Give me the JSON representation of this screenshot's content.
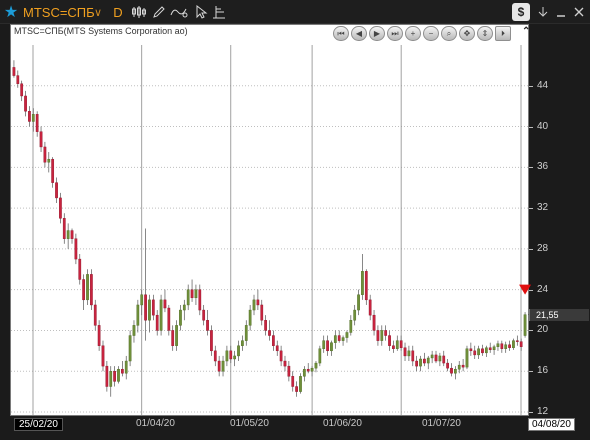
{
  "toolbar": {
    "symbol": "MTSC=СПБ",
    "symbol_caret": "∨",
    "period": "D",
    "tools": [
      "bar-chart-icon",
      "draw-pencil-icon",
      "indicator-icon",
      "cursor-icon",
      "chart-settings-icon"
    ],
    "right_tools": [
      "dollar-icon",
      "download-icon",
      "minimize-icon",
      "close-icon"
    ],
    "dollar_label": "$"
  },
  "chart": {
    "title": "MTSC=СПБ(MTS Systems Corporation ao)",
    "last_price": "21,55",
    "nav_buttons": [
      "first",
      "prev",
      "play",
      "next",
      "zoom-in",
      "zoom-out",
      "search",
      "fit-horizontal",
      "fit-vertical",
      "end"
    ]
  },
  "chart_data": {
    "type": "candlestick",
    "title": "MTSC=СПБ(MTS Systems Corporation ao)",
    "y_ticks": [
      12,
      16,
      20,
      24,
      28,
      32,
      36,
      40,
      44
    ],
    "ylim": [
      12,
      48
    ],
    "x_labels": [
      "25/02/20",
      "01/04/20",
      "01/05/20",
      "01/06/20",
      "01/07/20",
      "04/08/20"
    ],
    "last_price": 21.55,
    "up_color": "#6f8f3a",
    "down_color": "#c8243f",
    "alert_marker": 24,
    "candles": [
      [
        45.8,
        46.5,
        44.8,
        45.0
      ],
      [
        45.0,
        45.5,
        43.8,
        44.2
      ],
      [
        44.2,
        44.5,
        42.5,
        43.0
      ],
      [
        43.0,
        43.5,
        41.0,
        41.5
      ],
      [
        41.5,
        42.0,
        40.0,
        40.5
      ],
      [
        40.5,
        41.8,
        39.5,
        41.2
      ],
      [
        41.2,
        41.5,
        39.0,
        39.5
      ],
      [
        39.5,
        40.0,
        37.5,
        38.0
      ],
      [
        38.0,
        38.5,
        36.0,
        36.5
      ],
      [
        36.5,
        37.5,
        35.5,
        36.8
      ],
      [
        36.8,
        37.0,
        34.0,
        34.5
      ],
      [
        34.5,
        35.0,
        32.5,
        33.0
      ],
      [
        33.0,
        33.5,
        30.5,
        31.0
      ],
      [
        31.0,
        31.5,
        28.5,
        29.0
      ],
      [
        29.0,
        30.5,
        28.0,
        29.8
      ],
      [
        29.8,
        30.0,
        28.5,
        29.0
      ],
      [
        29.0,
        29.5,
        26.5,
        27.0
      ],
      [
        27.0,
        27.5,
        24.5,
        25.0
      ],
      [
        25.0,
        25.5,
        22.0,
        23.0
      ],
      [
        23.0,
        26.0,
        22.5,
        25.5
      ],
      [
        25.5,
        26.0,
        22.0,
        22.5
      ],
      [
        22.5,
        23.0,
        20.0,
        20.5
      ],
      [
        20.5,
        21.0,
        18.0,
        18.5
      ],
      [
        18.5,
        19.0,
        16.0,
        16.5
      ],
      [
        16.5,
        17.0,
        14.0,
        14.5
      ],
      [
        14.5,
        16.5,
        13.5,
        16.0
      ],
      [
        16.0,
        16.5,
        14.5,
        15.0
      ],
      [
        15.0,
        16.5,
        14.8,
        16.2
      ],
      [
        16.2,
        17.0,
        15.5,
        15.8
      ],
      [
        15.8,
        17.5,
        15.2,
        17.0
      ],
      [
        17.0,
        20.0,
        16.5,
        19.5
      ],
      [
        19.5,
        21.0,
        18.8,
        20.5
      ],
      [
        20.5,
        23.0,
        19.8,
        22.5
      ],
      [
        22.5,
        24.0,
        21.5,
        23.5
      ],
      [
        23.5,
        30.0,
        19.0,
        21.0
      ],
      [
        21.0,
        23.5,
        19.8,
        23.0
      ],
      [
        23.0,
        23.5,
        21.0,
        21.5
      ],
      [
        21.5,
        22.0,
        19.5,
        20.0
      ],
      [
        20.0,
        23.5,
        19.5,
        23.0
      ],
      [
        23.0,
        24.0,
        21.8,
        22.2
      ],
      [
        22.2,
        22.5,
        19.5,
        20.0
      ],
      [
        20.0,
        20.5,
        18.0,
        18.5
      ],
      [
        18.5,
        21.0,
        18.0,
        20.5
      ],
      [
        20.5,
        22.5,
        20.0,
        22.0
      ],
      [
        22.0,
        23.0,
        21.0,
        22.5
      ],
      [
        22.5,
        24.5,
        22.0,
        24.0
      ],
      [
        24.0,
        25.0,
        22.8,
        23.2
      ],
      [
        23.2,
        24.5,
        22.5,
        24.0
      ],
      [
        24.0,
        24.5,
        21.5,
        22.0
      ],
      [
        22.0,
        22.5,
        20.5,
        21.0
      ],
      [
        21.0,
        22.0,
        19.5,
        20.0
      ],
      [
        20.0,
        20.5,
        17.5,
        18.0
      ],
      [
        18.0,
        18.5,
        16.5,
        17.0
      ],
      [
        17.0,
        17.5,
        15.5,
        16.0
      ],
      [
        16.0,
        17.5,
        15.5,
        17.0
      ],
      [
        17.0,
        18.5,
        16.5,
        18.0
      ],
      [
        18.0,
        18.5,
        16.8,
        17.2
      ],
      [
        17.2,
        18.0,
        16.5,
        17.5
      ],
      [
        17.5,
        19.0,
        17.0,
        18.5
      ],
      [
        18.5,
        19.5,
        18.0,
        19.0
      ],
      [
        19.0,
        21.0,
        18.5,
        20.5
      ],
      [
        20.5,
        22.5,
        20.0,
        22.0
      ],
      [
        22.0,
        23.5,
        21.5,
        23.0
      ],
      [
        23.0,
        24.0,
        22.0,
        22.5
      ],
      [
        22.5,
        23.0,
        20.5,
        21.0
      ],
      [
        21.0,
        21.5,
        19.5,
        20.0
      ],
      [
        20.0,
        21.0,
        19.0,
        19.5
      ],
      [
        19.5,
        20.0,
        18.0,
        18.5
      ],
      [
        18.5,
        19.0,
        17.5,
        18.0
      ],
      [
        18.0,
        18.5,
        16.5,
        17.0
      ],
      [
        17.0,
        17.5,
        16.0,
        16.5
      ],
      [
        16.5,
        17.0,
        15.0,
        15.5
      ],
      [
        15.5,
        16.0,
        14.0,
        14.5
      ],
      [
        14.5,
        15.0,
        13.5,
        14.0
      ],
      [
        14.0,
        15.8,
        13.8,
        15.5
      ],
      [
        15.5,
        16.5,
        15.0,
        16.2
      ],
      [
        16.2,
        16.8,
        15.8,
        16.0
      ],
      [
        16.0,
        16.5,
        15.5,
        16.3
      ],
      [
        16.3,
        17.0,
        15.9,
        16.8
      ],
      [
        16.8,
        18.5,
        16.5,
        18.2
      ],
      [
        18.2,
        19.5,
        17.8,
        19.0
      ],
      [
        19.0,
        19.5,
        17.5,
        18.0
      ],
      [
        18.0,
        19.0,
        17.5,
        18.8
      ],
      [
        18.8,
        20.0,
        18.2,
        19.5
      ],
      [
        19.5,
        20.0,
        18.8,
        19.0
      ],
      [
        19.0,
        19.5,
        18.5,
        19.3
      ],
      [
        19.3,
        20.0,
        18.8,
        19.8
      ],
      [
        19.8,
        21.5,
        19.5,
        21.0
      ],
      [
        21.0,
        22.5,
        20.5,
        22.0
      ],
      [
        22.0,
        24.0,
        21.5,
        23.5
      ],
      [
        23.5,
        27.5,
        23.0,
        25.8
      ],
      [
        25.8,
        26.0,
        22.5,
        23.0
      ],
      [
        23.0,
        23.5,
        21.0,
        21.5
      ],
      [
        21.5,
        22.0,
        19.5,
        20.0
      ],
      [
        20.0,
        20.5,
        18.5,
        19.0
      ],
      [
        19.0,
        20.5,
        18.5,
        20.0
      ],
      [
        20.0,
        20.5,
        19.0,
        19.5
      ],
      [
        19.5,
        20.0,
        18.0,
        18.5
      ],
      [
        18.5,
        19.0,
        17.8,
        18.2
      ],
      [
        18.2,
        19.5,
        18.0,
        19.0
      ],
      [
        19.0,
        19.5,
        18.0,
        18.3
      ],
      [
        18.3,
        18.8,
        17.0,
        17.5
      ],
      [
        17.5,
        18.5,
        17.0,
        18.0
      ],
      [
        18.0,
        18.5,
        16.5,
        17.0
      ],
      [
        17.0,
        17.5,
        16.0,
        16.5
      ],
      [
        16.5,
        17.5,
        16.0,
        17.2
      ],
      [
        17.2,
        17.8,
        16.5,
        16.8
      ],
      [
        16.8,
        17.5,
        16.2,
        17.3
      ],
      [
        17.3,
        18.0,
        16.8,
        17.6
      ],
      [
        17.6,
        18.0,
        16.8,
        17.0
      ],
      [
        17.0,
        17.8,
        16.5,
        17.5
      ],
      [
        17.5,
        18.0,
        16.5,
        16.8
      ],
      [
        16.8,
        17.2,
        16.0,
        16.3
      ],
      [
        16.3,
        16.8,
        15.5,
        15.8
      ],
      [
        15.8,
        16.5,
        15.2,
        16.2
      ],
      [
        16.2,
        17.0,
        15.8,
        16.6
      ],
      [
        16.6,
        17.2,
        16.0,
        16.4
      ],
      [
        16.4,
        18.5,
        16.2,
        18.2
      ],
      [
        18.2,
        18.8,
        17.5,
        18.0
      ],
      [
        18.0,
        18.5,
        17.2,
        17.6
      ],
      [
        17.6,
        18.5,
        17.2,
        18.2
      ],
      [
        18.2,
        18.6,
        17.5,
        17.8
      ],
      [
        17.8,
        18.5,
        17.4,
        18.3
      ],
      [
        18.3,
        18.8,
        17.8,
        18.1
      ],
      [
        18.1,
        18.6,
        17.6,
        18.4
      ],
      [
        18.4,
        19.0,
        18.0,
        18.7
      ],
      [
        18.7,
        19.0,
        17.8,
        18.2
      ],
      [
        18.2,
        18.9,
        17.8,
        18.6
      ],
      [
        18.6,
        19.0,
        18.0,
        18.3
      ],
      [
        18.3,
        19.2,
        18.1,
        19.0
      ],
      [
        19.0,
        19.5,
        18.5,
        18.9
      ],
      [
        18.9,
        19.2,
        18.0,
        18.4
      ],
      [
        19.5,
        21.8,
        19.3,
        21.55
      ]
    ],
    "vlines": [
      "25/02/20",
      "01/04/20",
      "01/05/20",
      "01/06/20",
      "01/07/20",
      "04/08/20"
    ]
  }
}
